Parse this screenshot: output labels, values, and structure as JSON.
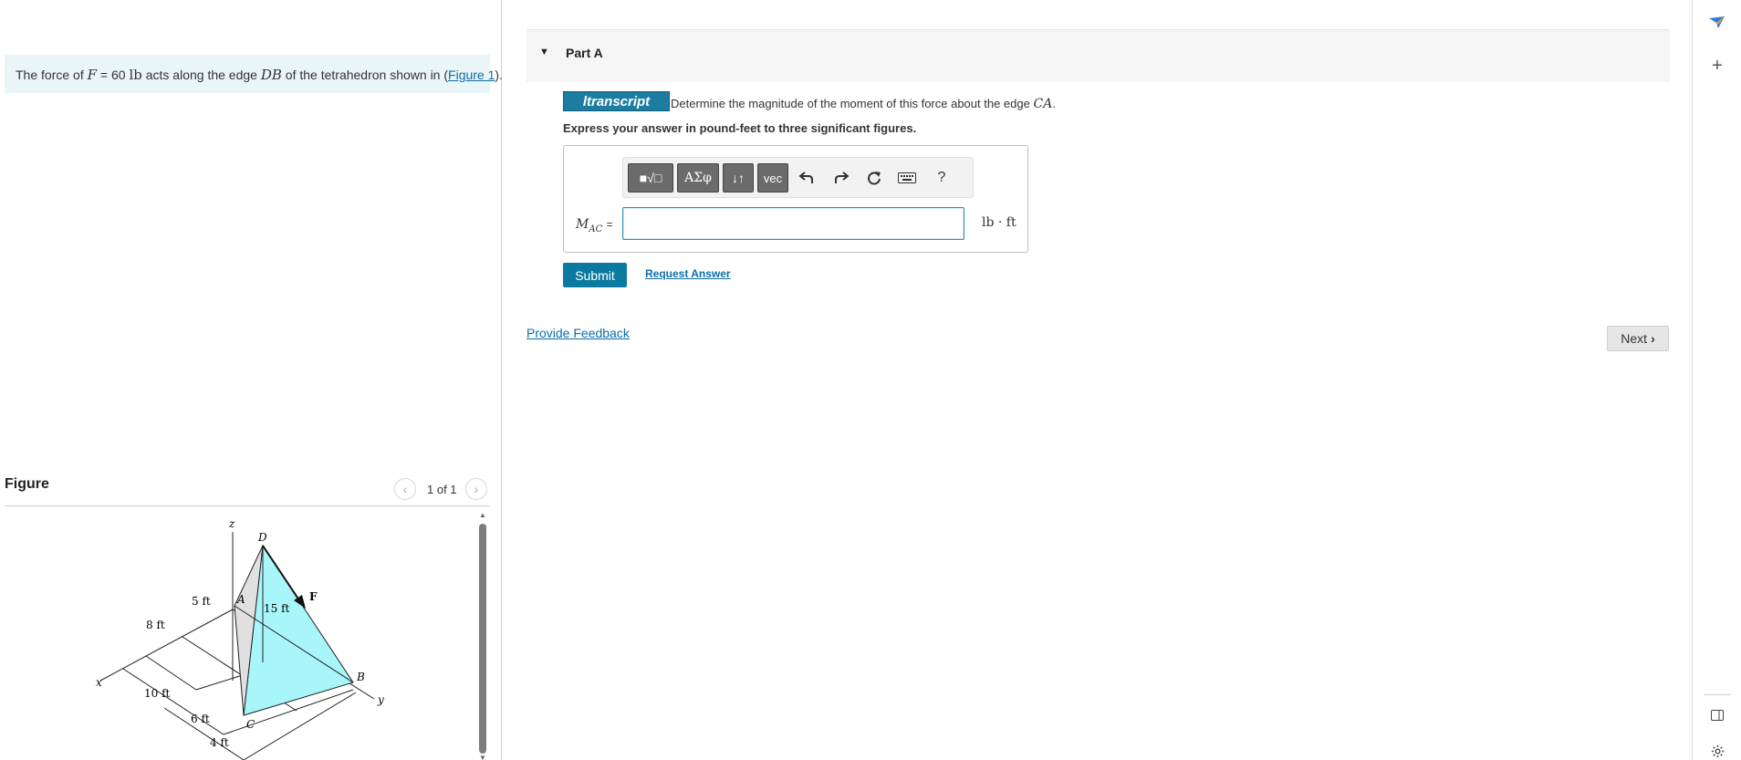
{
  "problem": {
    "prefix": "The force of",
    "force_var": "F",
    "equals": "= 60",
    "unit": "lb",
    "mid": "acts along the edge",
    "edge": "DB",
    "suffix": "of the tetrahedron shown in (",
    "link": "Figure 1",
    "close": ")."
  },
  "figure": {
    "title": "Figure",
    "counter": "1 of 1",
    "prev_icon": "chevron-left-icon",
    "next_icon": "chevron-right-icon",
    "labels": {
      "z": "z",
      "x": "x",
      "y": "y",
      "D": "D",
      "A": "A",
      "B": "B",
      "C": "C",
      "F": "F",
      "d15": "15 ft",
      "d5": "5 ft",
      "d8": "8 ft",
      "d10": "10 ft",
      "d6": "6 ft",
      "d4": "4 ft"
    }
  },
  "part": {
    "caret_icon": "caret-down-icon",
    "title": "Part A",
    "logo": "ltranscript",
    "question_text": "Determine the magnitude of the moment of this force about the edge",
    "question_edge": "CA",
    "question_end": ".",
    "instruction": "Express your answer in pound-feet to three significant figures.",
    "toolbar": {
      "templates": "■√□",
      "greek": "ΑΣφ",
      "arrows": "↓↑",
      "vec": "vec",
      "undo_icon": "undo-icon",
      "redo_icon": "redo-icon",
      "reset_icon": "reset-icon",
      "keyboard_icon": "keyboard-icon",
      "help": "?"
    },
    "var_main": "M",
    "var_sub": "AC",
    "var_eq": "=",
    "answer_value": "",
    "unit": "lb · ft",
    "submit": "Submit",
    "request": "Request Answer"
  },
  "feedback": "Provide Feedback",
  "next": "Next",
  "rail": {
    "icons": [
      "paper-plane-icon",
      "plus-icon",
      "sidebar-panel-icon",
      "settings-gear-icon"
    ]
  },
  "colors": {
    "accent": "#0b7aa0",
    "problem_bg": "#eaf5f8",
    "tetra_fill": "#a8f6f9",
    "link": "#0b6ea8"
  }
}
